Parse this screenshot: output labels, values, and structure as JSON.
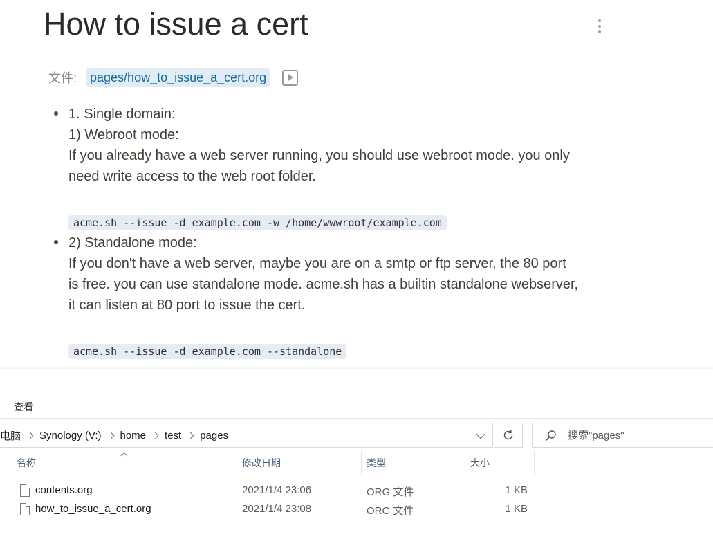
{
  "editor": {
    "title": "How to issue a cert",
    "file_label": "文件:",
    "file_path": "pages/how_to_issue_a_cert.org",
    "blocks": [
      {
        "lines": [
          "1. Single domain:",
          "1) Webroot mode:",
          "If you already have a web server running, you should use webroot mode. you only",
          "need write access to the web root folder."
        ],
        "code": "acme.sh --issue -d example.com -w /home/wwwroot/example.com"
      },
      {
        "lines": [
          "2) Standalone mode:",
          "If you don't have a web server, maybe you are on a smtp or ftp server, the 80 port",
          "is free. you can use standalone mode. acme.sh has a builtin standalone webserver,",
          "it can listen at 80 port to issue the cert."
        ],
        "code": "acme.sh --issue -d example.com --standalone"
      }
    ]
  },
  "explorer": {
    "ribbon_tab": "查看",
    "breadcrumb": [
      "电脑",
      "Synology (V:)",
      "home",
      "test",
      "pages"
    ],
    "search_placeholder": "搜索\"pages\"",
    "columns": {
      "name": "名称",
      "date": "修改日期",
      "type": "类型",
      "size": "大小"
    },
    "files": [
      {
        "name": "contents.org",
        "date": "2021/1/4 23:06",
        "type": "ORG 文件",
        "size": "1 KB"
      },
      {
        "name": "how_to_issue_a_cert.org",
        "date": "2021/1/4 23:08",
        "type": "ORG 文件",
        "size": "1 KB"
      }
    ],
    "icons": {
      "refresh": "refresh-icon",
      "search": "search-icon",
      "file": "file-icon",
      "dropdown": "chevron-down-icon"
    }
  }
}
